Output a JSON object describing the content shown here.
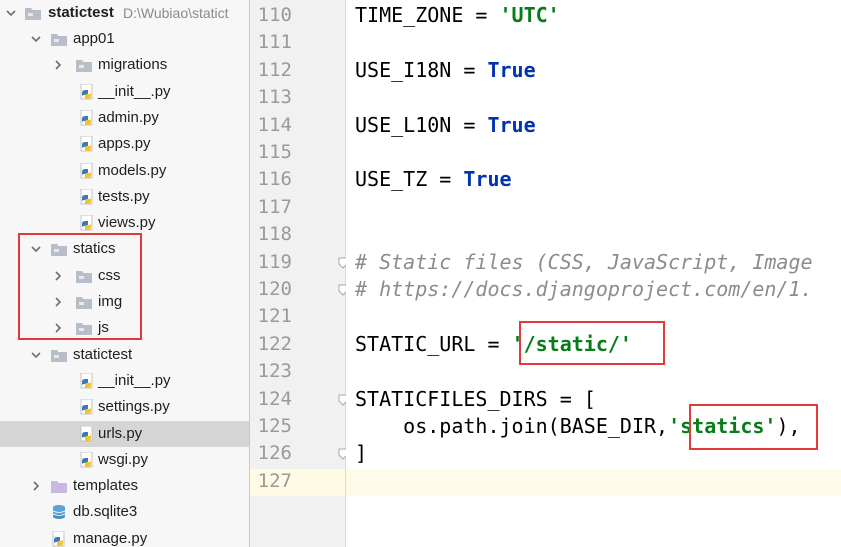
{
  "project_tree": {
    "root_label": "statictest",
    "root_path": "D:\\Wubiao\\statict",
    "items": [
      {
        "label": "app01",
        "kind": "folder",
        "depth": 1,
        "expanded": true
      },
      {
        "label": "migrations",
        "kind": "folder",
        "depth": 2,
        "expanded": false
      },
      {
        "label": "__init__.py",
        "kind": "py",
        "depth": 3
      },
      {
        "label": "admin.py",
        "kind": "py",
        "depth": 3
      },
      {
        "label": "apps.py",
        "kind": "py",
        "depth": 3
      },
      {
        "label": "models.py",
        "kind": "py",
        "depth": 3
      },
      {
        "label": "tests.py",
        "kind": "py",
        "depth": 3
      },
      {
        "label": "views.py",
        "kind": "py",
        "depth": 3
      },
      {
        "label": "statics",
        "kind": "folder",
        "depth": 1,
        "expanded": true
      },
      {
        "label": "css",
        "kind": "folder",
        "depth": 2,
        "expanded": false
      },
      {
        "label": "img",
        "kind": "folder",
        "depth": 2,
        "expanded": false
      },
      {
        "label": "js",
        "kind": "folder",
        "depth": 2,
        "expanded": false
      },
      {
        "label": "statictest",
        "kind": "folder",
        "depth": 1,
        "expanded": true
      },
      {
        "label": "__init__.py",
        "kind": "py",
        "depth": 3
      },
      {
        "label": "settings.py",
        "kind": "py",
        "depth": 3
      },
      {
        "label": "urls.py",
        "kind": "py",
        "depth": 3,
        "selected": true
      },
      {
        "label": "wsgi.py",
        "kind": "py",
        "depth": 3
      },
      {
        "label": "templates",
        "kind": "template-folder",
        "depth": 1,
        "expanded": false
      },
      {
        "label": "db.sqlite3",
        "kind": "db",
        "depth": 1
      },
      {
        "label": "manage.py",
        "kind": "py",
        "depth": 1
      }
    ]
  },
  "editor": {
    "lines": [
      {
        "num": "110",
        "tokens": [
          {
            "t": "TIME_ZONE = ",
            "c": "plain"
          },
          {
            "t": "'UTC'",
            "c": "str"
          }
        ]
      },
      {
        "num": "111",
        "tokens": []
      },
      {
        "num": "112",
        "tokens": [
          {
            "t": "USE_I18N = ",
            "c": "plain"
          },
          {
            "t": "True",
            "c": "kw"
          }
        ]
      },
      {
        "num": "113",
        "tokens": []
      },
      {
        "num": "114",
        "tokens": [
          {
            "t": "USE_L10N = ",
            "c": "plain"
          },
          {
            "t": "True",
            "c": "kw"
          }
        ]
      },
      {
        "num": "115",
        "tokens": []
      },
      {
        "num": "116",
        "tokens": [
          {
            "t": "USE_TZ = ",
            "c": "plain"
          },
          {
            "t": "True",
            "c": "kw"
          }
        ]
      },
      {
        "num": "117",
        "tokens": []
      },
      {
        "num": "118",
        "tokens": []
      },
      {
        "num": "119",
        "tokens": [
          {
            "t": "# Static files (CSS, JavaScript, Image",
            "c": "cmt"
          }
        ],
        "fold": true
      },
      {
        "num": "120",
        "tokens": [
          {
            "t": "# https://docs.djangoproject.com/en/1.",
            "c": "cmt"
          }
        ],
        "fold": true
      },
      {
        "num": "121",
        "tokens": []
      },
      {
        "num": "122",
        "tokens": [
          {
            "t": "STATIC_URL = ",
            "c": "plain"
          },
          {
            "t": "'/static/'",
            "c": "str"
          }
        ]
      },
      {
        "num": "123",
        "tokens": []
      },
      {
        "num": "124",
        "tokens": [
          {
            "t": "STATICFILES_DIRS = [",
            "c": "plain"
          }
        ],
        "fold": true
      },
      {
        "num": "125",
        "tokens": [
          {
            "t": "    os.path.join(BASE_DIR,",
            "c": "plain"
          },
          {
            "t": "'statics'",
            "c": "str"
          },
          {
            "t": "),",
            "c": "plain"
          }
        ]
      },
      {
        "num": "126",
        "tokens": [
          {
            "t": "]",
            "c": "plain"
          }
        ],
        "fold": true
      },
      {
        "num": "127",
        "tokens": [],
        "current": true
      }
    ]
  },
  "colors": {
    "string": "#067d17",
    "keyword": "#0033b3",
    "comment": "#8c8c8c",
    "highlight_box": "#e03a3a",
    "selection": "#d5d5d5"
  }
}
